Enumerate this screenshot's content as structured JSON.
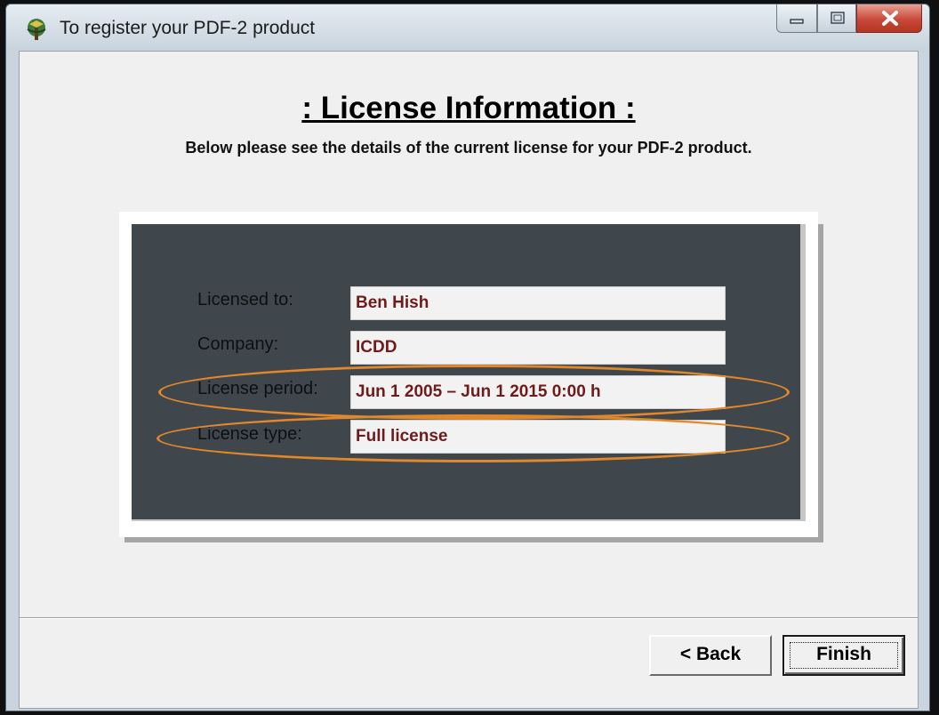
{
  "window": {
    "title": "To register your PDF-2 product"
  },
  "main": {
    "heading": ": License Information :",
    "subheading": "Below please see the details of the current license for your PDF-2 product."
  },
  "license": {
    "rows": [
      {
        "label": "Licensed to:",
        "value": "Ben Hish"
      },
      {
        "label": "Company:",
        "value": "ICDD"
      },
      {
        "label": "License period:",
        "value": "Jun 1 2005 – Jun 1 2015 0:00 h"
      },
      {
        "label": "License type:",
        "value": "Full license"
      }
    ]
  },
  "buttons": {
    "back": "< Back",
    "finish": "Finish"
  },
  "colors": {
    "panel": "#3f474d",
    "value_text": "#6e1b1b",
    "highlight": "#e2872a"
  },
  "icons": {
    "app": "pdf2-app-icon",
    "minimize": "minimize-icon",
    "maximize": "maximize-icon",
    "close": "close-icon"
  }
}
